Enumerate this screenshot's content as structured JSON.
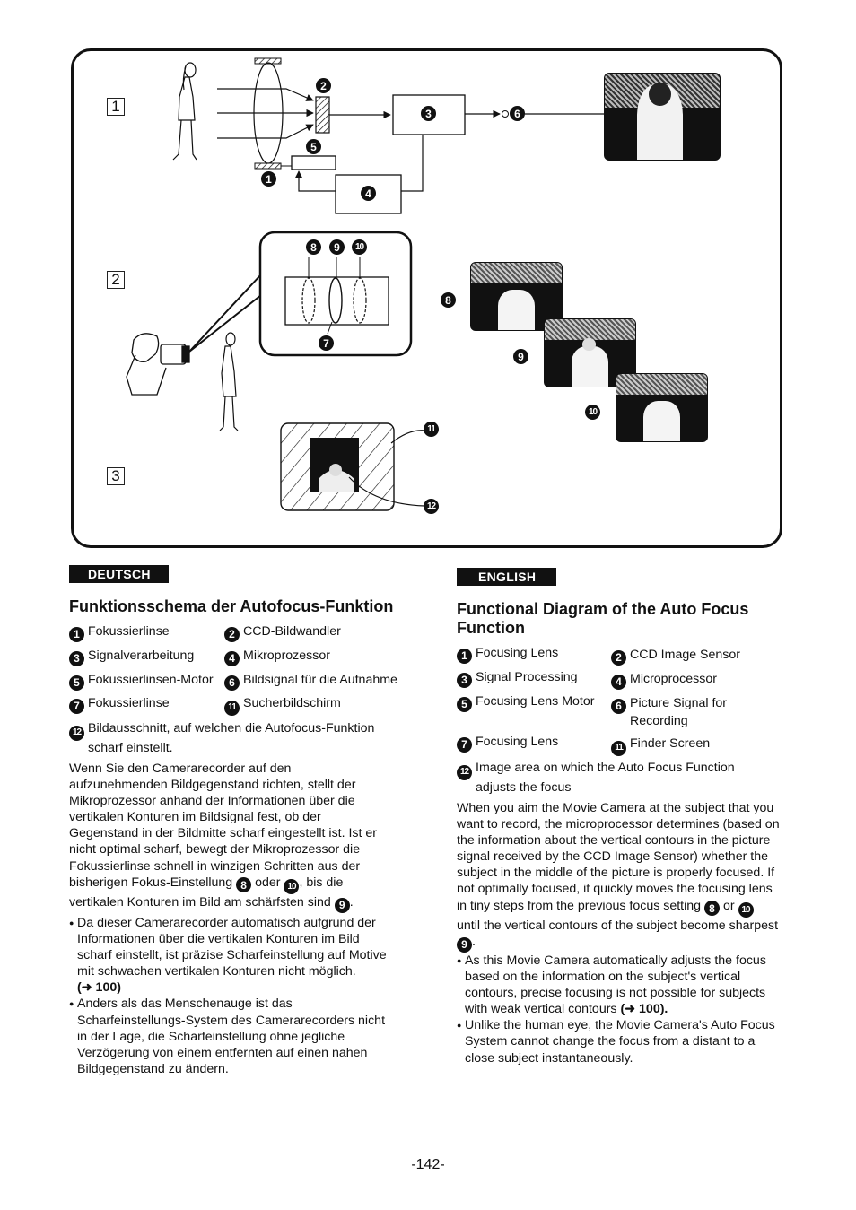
{
  "diagram": {
    "step_labels": [
      "1",
      "2",
      "3"
    ],
    "callouts": [
      "1",
      "2",
      "3",
      "4",
      "5",
      "6",
      "7",
      "8",
      "9",
      "10",
      "11",
      "12"
    ]
  },
  "deutsch": {
    "lang_label": "DEUTSCH",
    "title": "Funktionsschema der Autofocus-Funktion",
    "legend": [
      {
        "num": "1",
        "text": "Fokussierlinse"
      },
      {
        "num": "2",
        "text": "CCD-Bildwandler"
      },
      {
        "num": "3",
        "text": "Signalverarbeitung"
      },
      {
        "num": "4",
        "text": "Mikroprozessor"
      },
      {
        "num": "5",
        "text": "Fokussierlinsen-Motor"
      },
      {
        "num": "6",
        "text": "Bildsignal für die Aufnahme"
      },
      {
        "num": "7",
        "text": "Fokussierlinse"
      },
      {
        "num": "11",
        "text": "Sucherbildschirm"
      },
      {
        "num": "12",
        "text": "Bildausschnitt, auf welchen die Autofocus-Funktion scharf einstellt."
      }
    ],
    "paragraph_parts": {
      "p1": "Wenn Sie den Camerarecorder auf den aufzunehmenden Bildgegenstand richten, stellt der Mikroprozessor anhand der Informationen über die vertikalen Konturen im Bildsignal fest, ob der Gegenstand in der Bildmitte scharf eingestellt ist. Ist er nicht optimal scharf, bewegt der Mikroprozessor die Fokussierlinse schnell in winzigen Schritten aus der bisherigen Fokus-Einstellung",
      "ref_a": "8",
      "p2": "oder",
      "ref_b": "10",
      "p3": ", bis die vertikalen Konturen im Bild am schärfsten sind",
      "ref_c": "9",
      "p4": "."
    },
    "bullets": [
      {
        "text": "Da dieser Camerarecorder automatisch aufgrund der Informationen über die vertikalen Konturen im Bild scharf einstellt, ist präzise Scharfeinstellung auf Motive mit schwachen vertikalen Konturen nicht möglich.",
        "ref": "(➜ 100)"
      },
      {
        "text": "Anders als das Menschenauge ist das Scharfeinstellungs-System des Camerarecorders nicht in der Lage, die Scharfeinstellung ohne jegliche Verzögerung von einem entfernten auf einen nahen Bildgegenstand zu ändern.",
        "ref": ""
      }
    ]
  },
  "english": {
    "lang_label": "ENGLISH",
    "title": "Functional Diagram of the Auto Focus Function",
    "legend": [
      {
        "num": "1",
        "text": "Focusing Lens"
      },
      {
        "num": "2",
        "text": "CCD Image Sensor"
      },
      {
        "num": "3",
        "text": "Signal Processing"
      },
      {
        "num": "4",
        "text": "Microprocessor"
      },
      {
        "num": "5",
        "text": "Focusing Lens Motor"
      },
      {
        "num": "6",
        "text": "Picture Signal for Recording"
      },
      {
        "num": "7",
        "text": "Focusing Lens"
      },
      {
        "num": "11",
        "text": "Finder Screen"
      },
      {
        "num": "12",
        "text": "Image area on which the Auto Focus Function adjusts the focus"
      }
    ],
    "paragraph_parts": {
      "p1": "When you aim the Movie Camera at the subject that you want to record, the microprocessor determines (based on the information about the vertical contours in the picture signal received by the CCD Image Sensor) whether the subject in the middle of the picture is properly focused. If not optimally focused, it quickly moves the focusing lens  in tiny steps from the previous focus setting",
      "ref_a": "8",
      "p2": "or",
      "ref_b": "10",
      "p3": "until the vertical contours of the subject become sharpest",
      "ref_c": "9",
      "p4": "."
    },
    "bullets": [
      {
        "text": "As this Movie Camera automatically adjusts the focus based on the information on the subject's vertical contours, precise focusing is not possible for subjects with weak vertical contours",
        "ref": "(➜ 100)."
      },
      {
        "text": "Unlike the human eye, the Movie Camera's Auto Focus System cannot change the focus from a distant to a close subject instantaneously.",
        "ref": ""
      }
    ]
  },
  "page_number": "-142-"
}
